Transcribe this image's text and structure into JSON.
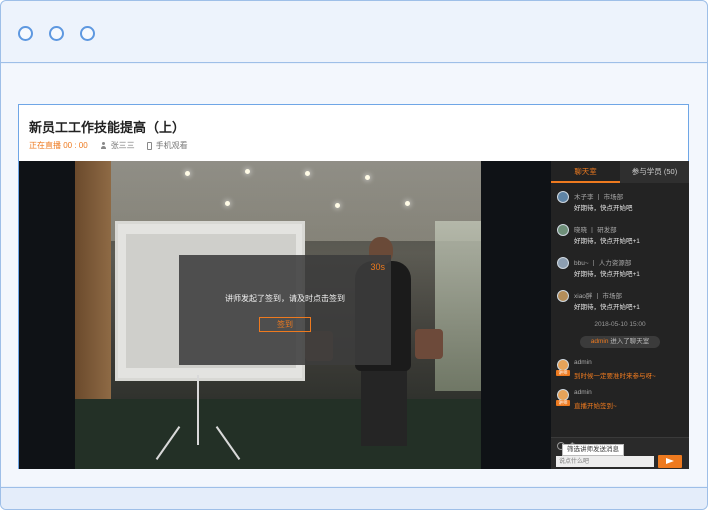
{
  "course": {
    "title": "新员工工作技能提高（上）",
    "live_status": "正在直播 00 : 00",
    "presenter": "张三三",
    "watch_mode": "手机观看"
  },
  "signin_modal": {
    "timer": "30s",
    "message": "讲师发起了签到，请及时点击签到",
    "button_label": "签到"
  },
  "sidebar": {
    "tabs": [
      {
        "label": "聊天室",
        "active": true
      },
      {
        "label": "参与学员 (50)",
        "active": false
      }
    ],
    "messages": [
      {
        "name": "木子李 丨 市场部",
        "text": "好期待，快点开始吧"
      },
      {
        "name": "晓晓 丨 研发部",
        "text": "好期待，快点开始吧+1"
      },
      {
        "name": "bbu~ 丨 人力资源部",
        "text": "好期待，快点开始吧+1"
      },
      {
        "name": "xiao胖 丨 市场部",
        "text": "好期待，快点开始吧+1"
      }
    ],
    "timestamp": "2018-05-10 15:00",
    "join_notice": {
      "user": "admin",
      "text": "进入了聊天室"
    },
    "admin_messages": [
      {
        "name": "admin",
        "tag": "讲师",
        "text": "到时候一定要准时来参与呀~"
      },
      {
        "name": "admin",
        "tag": "讲师",
        "text": "直播开始签到~"
      }
    ],
    "input_placeholder": "说点什么吧",
    "tooltip": "筛选讲师发送消息"
  },
  "colors": {
    "accent": "#ee7a1f",
    "frame_border": "#9ebfe8",
    "sidebar_bg": "#232323"
  }
}
